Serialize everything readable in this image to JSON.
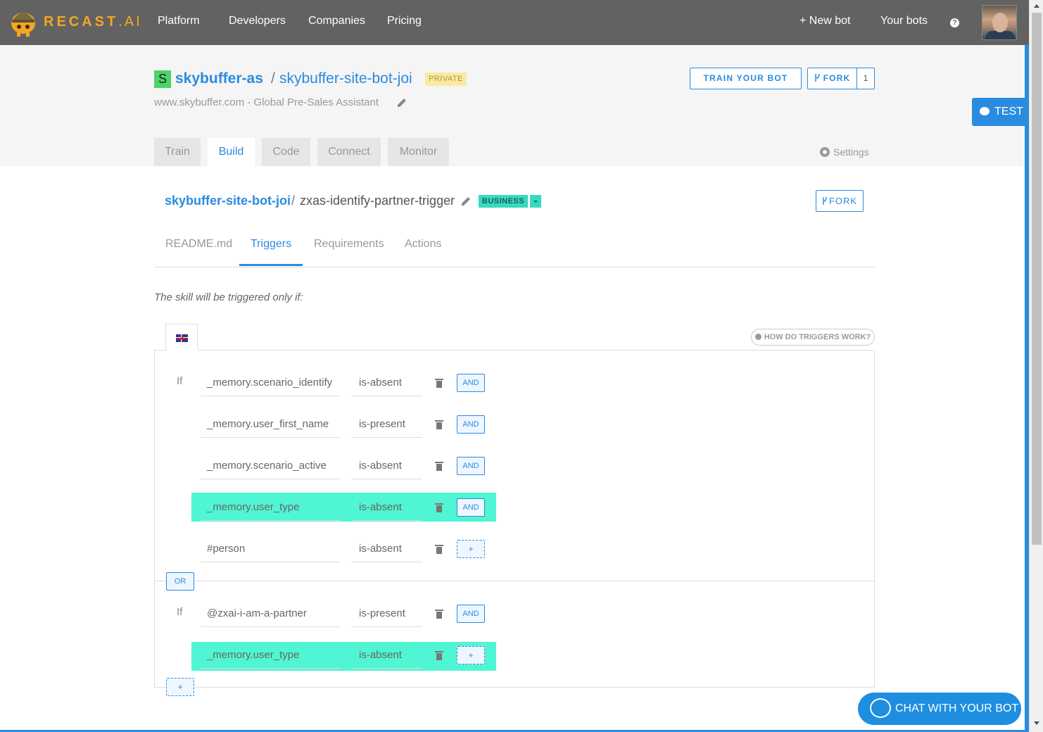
{
  "nav": {
    "brand": "RECAST",
    "brand_suffix": ".AI",
    "links": [
      "Platform",
      "Developers",
      "Companies",
      "Pricing"
    ],
    "new_bot": "+  New bot",
    "your_bots": "Your bots",
    "help": "?"
  },
  "bot": {
    "org_initial": "S",
    "org": "skybuffer-as",
    "separator": "/",
    "name": "skybuffer-site-bot-joi",
    "visibility": "PRIVATE",
    "description": "www.skybuffer.com - Global Pre-Sales Assistant",
    "train_label": "TRAIN YOUR BOT",
    "fork_label": "FORK",
    "fork_count": "1",
    "test_label": "TEST"
  },
  "tabs": [
    {
      "label": "Train",
      "active": false
    },
    {
      "label": "Build",
      "active": true
    },
    {
      "label": "Code",
      "active": false
    },
    {
      "label": "Connect",
      "active": false
    },
    {
      "label": "Monitor",
      "active": false
    }
  ],
  "settings_label": "Settings",
  "skill": {
    "bot": "skybuffer-site-bot-joi",
    "separator": "/",
    "name": "zxas-identify-partner-trigger",
    "badge": "BUSINESS",
    "fork_label": "FORK"
  },
  "subtabs": [
    {
      "label": "README.md",
      "active": false
    },
    {
      "label": "Triggers",
      "active": true
    },
    {
      "label": "Requirements",
      "active": false
    },
    {
      "label": "Actions",
      "active": false
    }
  ],
  "intro": "The skill will be triggered only if:",
  "language": "en",
  "how_triggers": "HOW DO TRIGGERS WORK?",
  "if_label": "If",
  "or_label": "OR",
  "and_label": "AND",
  "plus_label": "+",
  "groups": [
    {
      "conditions": [
        {
          "field": "_memory.scenario_identify",
          "operator": "is-absent",
          "highlight": false,
          "connector": "AND"
        },
        {
          "field": "_memory.user_first_name",
          "operator": "is-present",
          "highlight": false,
          "connector": "AND"
        },
        {
          "field": "_memory.scenario_active",
          "operator": "is-absent",
          "highlight": false,
          "connector": "AND"
        },
        {
          "field": "_memory.user_type",
          "operator": "is-absent",
          "highlight": true,
          "connector": "AND"
        },
        {
          "field": "#person",
          "operator": "is-absent",
          "highlight": false,
          "connector": "+"
        }
      ]
    },
    {
      "conditions": [
        {
          "field": "@zxai-i-am-a-partner",
          "operator": "is-present",
          "highlight": false,
          "connector": "AND"
        },
        {
          "field": "_memory.user_type",
          "operator": "is-absent",
          "highlight": true,
          "connector": "+"
        }
      ]
    }
  ],
  "chat_label": "CHAT WITH YOUR BOT",
  "colors": {
    "accent": "#2a8be0",
    "highlight": "#50f5d3",
    "business": "#37d9c2",
    "private": "#fbeaa5",
    "nav": "#626262"
  }
}
